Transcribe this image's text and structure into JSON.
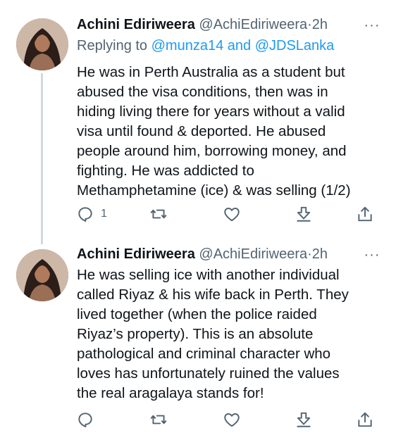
{
  "tweets": [
    {
      "author_name": "Achini Ediriweera",
      "handle": "@AchiEdiriweera",
      "separator": "·",
      "time": "2h",
      "more": "···",
      "replying_prefix": "Replying to",
      "replying_handles": [
        "@munza14",
        "@JDSLanka"
      ],
      "replying_join": "and",
      "lines": [
        "He was in Perth Australia as a student but",
        "abused the visa conditions, then was in",
        "hiding living there for years without a valid",
        "visa until found & deported. He abused",
        "people around him, borrowing money, and",
        "fighting. He was addicted to",
        "Methamphetamine (ice) & was selling (1/2)"
      ],
      "reply_count": "1"
    },
    {
      "author_name": "Achini Ediriweera",
      "handle": "@AchiEdiriweera",
      "separator": "·",
      "time": "2h",
      "more": "···",
      "lines": [
        "He was selling ice with another individual",
        "called Riyaz & his wife back in Perth. They",
        "lived together (when the police raided",
        "Riyaz’s property). This is an absolute",
        "pathological and criminal character who",
        "loves has unfortunately ruined the values",
        "the real aragalaya stands for!"
      ],
      "reply_count": ""
    }
  ],
  "icons": {
    "reply": "reply-icon",
    "retweet": "retweet-icon",
    "like": "like-icon",
    "download": "download-icon",
    "share": "share-icon",
    "more": "more-icon"
  },
  "colors": {
    "text": "#0f1419",
    "secondary": "#536471",
    "link": "#1d9bf0",
    "thread_line": "#cfd9de"
  }
}
